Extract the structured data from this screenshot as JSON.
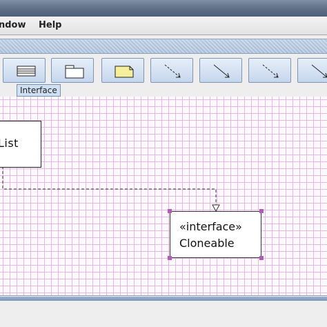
{
  "menubar": {
    "window_label": "ndow",
    "help_label": "Help"
  },
  "toolbar": {
    "buttons": [
      {
        "name": "interface-tool-button",
        "icon": "interface-icon"
      },
      {
        "name": "package-tool-button",
        "icon": "package-icon"
      },
      {
        "name": "note-tool-button",
        "icon": "note-icon"
      },
      {
        "name": "dependency-tool-button",
        "icon": "dashed-arrow-icon"
      },
      {
        "name": "association-tool-button",
        "icon": "solid-arrow-icon"
      },
      {
        "name": "generalization-tool-button",
        "icon": "dashed-arrow-icon"
      },
      {
        "name": "aggregation-tool-button",
        "icon": "solid-arrow-icon"
      }
    ],
    "tooltip": "Interface"
  },
  "diagram": {
    "class_node": {
      "name": "yList"
    },
    "interface_node": {
      "stereotype": "«interface»",
      "name": "Cloneable"
    }
  },
  "colors": {
    "grid": "#e3b8e1",
    "selection_handle": "#b05cb8",
    "toolbar_button": "#c5d6ec",
    "note_fill": "#f5ee9a"
  }
}
